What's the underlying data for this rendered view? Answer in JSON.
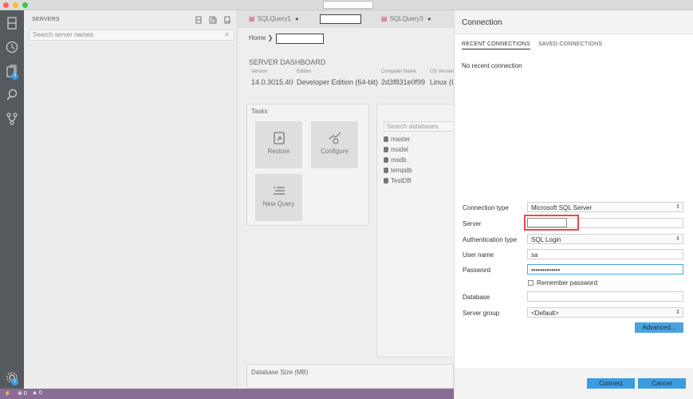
{
  "window": {
    "traffic_lights": [
      "close",
      "minimize",
      "zoom"
    ]
  },
  "activity_bar": {
    "items": [
      {
        "icon": "servers-icon"
      },
      {
        "icon": "history-icon"
      },
      {
        "icon": "files-icon",
        "badge": "3"
      },
      {
        "icon": "search-icon"
      },
      {
        "icon": "source-control-icon"
      }
    ],
    "settings_badge": "1"
  },
  "sidebar": {
    "title": "SERVERS",
    "search_placeholder": "Search server names"
  },
  "editor": {
    "tabs": [
      {
        "label": "SQLQuery1",
        "dirty": "●"
      },
      {
        "label": "SQLQuery3",
        "dirty": "●"
      }
    ],
    "breadcrumb_home": "Home",
    "dashboard": {
      "title": "SERVER DASHBOARD",
      "fields": [
        {
          "label": "Version",
          "value": "14.0.3015.40"
        },
        {
          "label": "Edition",
          "value": "Developer Edition (64-bit)"
        },
        {
          "label": "Computer Name",
          "value": "2d3f831e0f99"
        },
        {
          "label": "OS Version",
          "value": "Linux (U"
        }
      ]
    },
    "tasks": {
      "title": "Tasks",
      "items": [
        "Restore",
        "Configure",
        "New Query"
      ]
    },
    "databases": {
      "search_placeholder": "Search databases",
      "items": [
        "master",
        "model",
        "msdb",
        "tempdb",
        "TestDB"
      ]
    },
    "db_size_title": "Database Size (MB)"
  },
  "connection": {
    "title": "Connection",
    "tabs": [
      "RECENT CONNECTIONS",
      "SAVED CONNECTIONS"
    ],
    "no_recent": "No recent connection",
    "labels": {
      "connection_type": "Connection type",
      "server": "Server",
      "auth_type": "Authentication type",
      "user_name": "User name",
      "password": "Password",
      "remember": "Remember password",
      "database": "Database",
      "server_group": "Server group"
    },
    "values": {
      "connection_type": "Microsoft SQL Server",
      "auth_type": "SQL Login",
      "user_name": "sa",
      "password": "•••••••••••••",
      "server_group": "<Default>"
    },
    "buttons": {
      "advanced": "Advanced...",
      "connect": "Connect",
      "cancel": "Cancel"
    },
    "accent_color": "#3c9ce0",
    "highlight_color": "#e14b4b"
  },
  "statusbar": {
    "errors": "0",
    "warnings": "0"
  }
}
